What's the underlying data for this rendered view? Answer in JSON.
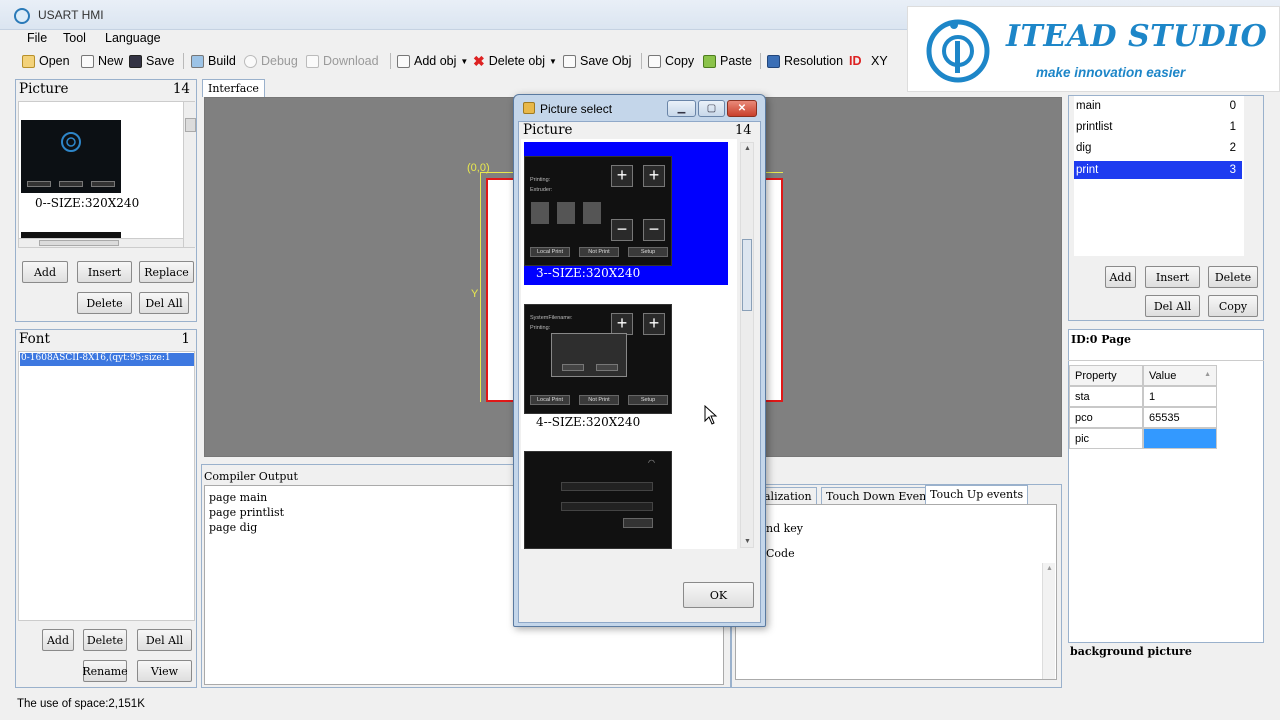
{
  "app": {
    "title": "USART HMI"
  },
  "menu": [
    "File",
    "Tool",
    "Language"
  ],
  "toolbar": {
    "open": "Open",
    "new": "New",
    "save": "Save",
    "build": "Build",
    "debug": "Debug",
    "download": "Download",
    "add_obj": "Add obj",
    "delete_obj": "Delete obj",
    "save_obj": "Save Obj",
    "copy": "Copy",
    "paste": "Paste",
    "resolution": "Resolution",
    "id": "ID",
    "xy": "XY"
  },
  "logo": {
    "title": "ITEAD STUDIO",
    "subtitle": "make innovation easier"
  },
  "picture_panel": {
    "title": "Picture",
    "count": "14",
    "item_caption": "0--SIZE:320X240",
    "buttons": {
      "add": "Add",
      "insert": "Insert",
      "replace": "Replace",
      "delete": "Delete",
      "del_all": "Del All"
    }
  },
  "font_panel": {
    "title": "Font",
    "count": "1",
    "item": "0-1608ASCII-8X16,(qyt:95;size:1",
    "buttons": {
      "add": "Add",
      "delete": "Delete",
      "del_all": "Del All",
      "rename": "Rename",
      "view": "View"
    }
  },
  "interface_tab": "Interface",
  "canvas": {
    "origin": "(0,0)",
    "y_axis": "Y"
  },
  "compiler": {
    "title": "Compiler Output",
    "lines": [
      "page main",
      "page printlist",
      "page dig"
    ]
  },
  "events": {
    "tabs": [
      "alization",
      "Touch Down Events",
      "Touch Up events"
    ],
    "line1": "nd key",
    "line2": "Code"
  },
  "pages": [
    {
      "name": "main",
      "index": "0"
    },
    {
      "name": "printlist",
      "index": "1"
    },
    {
      "name": "dig",
      "index": "2"
    },
    {
      "name": "print",
      "index": "3"
    }
  ],
  "pages_buttons": {
    "add": "Add",
    "insert": "Insert",
    "delete": "Delete",
    "del_all": "Del All",
    "copy": "Copy"
  },
  "property_panel": {
    "title": "ID:0 Page",
    "headers": [
      "Property",
      "Value"
    ],
    "rows": [
      {
        "property": "sta",
        "value": "1"
      },
      {
        "property": "pco",
        "value": "65535"
      },
      {
        "property": "pic",
        "value": ""
      }
    ],
    "description": "background picture"
  },
  "status": {
    "space": "The use of space:2,151K"
  },
  "dialog": {
    "title": "Picture select",
    "list_title": "Picture",
    "list_count": "14",
    "items": [
      {
        "caption": "3--SIZE:320X240",
        "selected": true,
        "thumb_buttons": [
          "Local Print",
          "Not Print",
          "Setup"
        ]
      },
      {
        "caption": "4--SIZE:320X240",
        "selected": false,
        "thumb_buttons": [
          "Local Print",
          "Not Print",
          "Setup"
        ]
      }
    ],
    "ok": "OK"
  },
  "colors": {
    "selection": "#1e3bf0",
    "canvas": "#808080",
    "accent": "#1d86c8"
  }
}
